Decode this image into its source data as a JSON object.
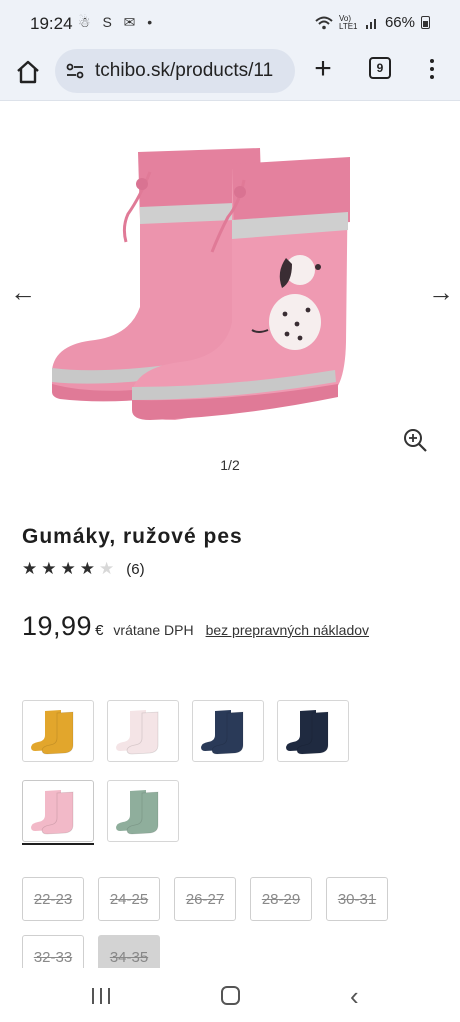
{
  "status_bar": {
    "time": "19:24",
    "left_icons": "☃ S ✉ •",
    "battery": "66%",
    "signal_label": "Vo) LTE1"
  },
  "browser": {
    "url": "tchibo.sk/products/11",
    "tab_count": "9"
  },
  "gallery": {
    "counter": "1/2"
  },
  "product": {
    "title": "Gumáky, ružové pes",
    "rating_value": 4,
    "rating_max": 5,
    "rating_count": "(6)",
    "price": "19,99",
    "currency": "€",
    "vat_note": "vrátane DPH",
    "shipping_link": "bez prepravných nákladov"
  },
  "color_variants": [
    {
      "name": "yellow",
      "boot_color": "#e2a62c",
      "selected": false
    },
    {
      "name": "light-pink-white",
      "boot_color": "#f4e4e6",
      "selected": false
    },
    {
      "name": "navy",
      "boot_color": "#2a3a58",
      "selected": false
    },
    {
      "name": "dark-navy",
      "boot_color": "#1f2a40",
      "selected": false
    },
    {
      "name": "pink",
      "boot_color": "#f2b9c8",
      "selected": true
    },
    {
      "name": "sage-green",
      "boot_color": "#8fae9c",
      "selected": false
    }
  ],
  "sizes": [
    {
      "label": "22-23",
      "available": false,
      "selected": false
    },
    {
      "label": "24-25",
      "available": false,
      "selected": false
    },
    {
      "label": "26-27",
      "available": false,
      "selected": false
    },
    {
      "label": "28-29",
      "available": false,
      "selected": false
    },
    {
      "label": "30-31",
      "available": false,
      "selected": false
    },
    {
      "label": "32-33",
      "available": false,
      "selected": false
    },
    {
      "label": "34-35",
      "available": false,
      "selected": true
    }
  ],
  "colors": {
    "boot_pink": "#ec8fa9",
    "boot_pink_dark": "#e07a97",
    "reflective_stripe": "#c9c9c9"
  }
}
